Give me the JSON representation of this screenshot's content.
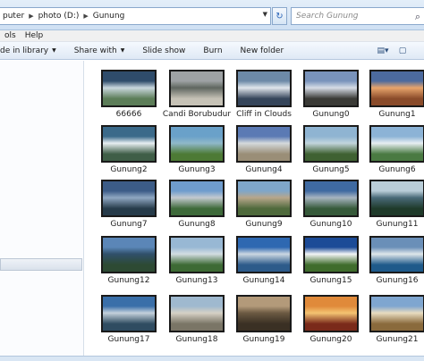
{
  "address": {
    "crumbs": [
      "puter",
      "photo (D:)",
      "Gunung"
    ]
  },
  "search": {
    "placeholder": "Search Gunung"
  },
  "menu": {
    "items": [
      "ols",
      "Help"
    ]
  },
  "commands": {
    "include": "de in library",
    "share": "Share with",
    "slideshow": "Slide show",
    "burn": "Burn",
    "newfolder": "New folder"
  },
  "icons": {
    "views": "view-options-icon",
    "preview": "preview-pane-icon",
    "help": "help-icon",
    "refresh": "refresh-icon",
    "search": "search-icon"
  },
  "files": [
    {
      "name": "66666",
      "c1": "#2f4c6b",
      "c2": "#c9d7de",
      "c3": "#5c7d58"
    },
    {
      "name": "Candi Borubudur",
      "c1": "#9ea2a4",
      "c2": "#5f6660",
      "c3": "#c6c2b6"
    },
    {
      "name": "Cliff in Clouds",
      "c1": "#6d8aa7",
      "c2": "#e0e6ec",
      "c3": "#35455a"
    },
    {
      "name": "Gunung0",
      "c1": "#7993bb",
      "c2": "#d6dce6",
      "c3": "#3a3a36"
    },
    {
      "name": "Gunung1",
      "c1": "#4c6a9e",
      "c2": "#e7a46c",
      "c3": "#8a4b2a"
    },
    {
      "name": "Gunung2",
      "c1": "#3b6a8a",
      "c2": "#e7eef2",
      "c3": "#3f5e47"
    },
    {
      "name": "Gunung3",
      "c1": "#6aa1c9",
      "c2": "#8fb8c9",
      "c3": "#4d7a35"
    },
    {
      "name": "Gunung4",
      "c1": "#5b7ab4",
      "c2": "#d4d9dc",
      "c3": "#9a8e77"
    },
    {
      "name": "Gunung5",
      "c1": "#8fb4d2",
      "c2": "#c2d5dc",
      "c3": "#3f6132"
    },
    {
      "name": "Gunung6",
      "c1": "#8cb3d6",
      "c2": "#e7eef2",
      "c3": "#4a7a42"
    },
    {
      "name": "Gunung7",
      "c1": "#3c5c87",
      "c2": "#8fa7c2",
      "c3": "#263b4a"
    },
    {
      "name": "Gunung8",
      "c1": "#6f9ccd",
      "c2": "#c3c9cf",
      "c3": "#3e6a3a"
    },
    {
      "name": "Gunung9",
      "c1": "#7fa6c9",
      "c2": "#b7a68b",
      "c3": "#4f6a3c"
    },
    {
      "name": "Gunung10",
      "c1": "#3f6aa1",
      "c2": "#a7b4c0",
      "c3": "#365a3a"
    },
    {
      "name": "Gunung11",
      "c1": "#b9cdd8",
      "c2": "#496a78",
      "c3": "#1f3a2a"
    },
    {
      "name": "Gunung12",
      "c1": "#5b86b7",
      "c2": "#30506b",
      "c3": "#2d4a33"
    },
    {
      "name": "Gunung13",
      "c1": "#98b8d4",
      "c2": "#d3dde2",
      "c3": "#3d6a34"
    },
    {
      "name": "Gunung14",
      "c1": "#2e68b1",
      "c2": "#cbd7e2",
      "c3": "#2d5b8a"
    },
    {
      "name": "Gunung15",
      "c1": "#1c4b97",
      "c2": "#f2f4f6",
      "c3": "#3f6c2c"
    },
    {
      "name": "Gunung16",
      "c1": "#6a8fb8",
      "c2": "#dfe6ea",
      "c3": "#1f5a8a"
    },
    {
      "name": "Gunung17",
      "c1": "#3a6fa9",
      "c2": "#c4d1dc",
      "c3": "#2f4c61"
    },
    {
      "name": "Gunung18",
      "c1": "#9fb9cf",
      "c2": "#d6d1c5",
      "c3": "#7a7566"
    },
    {
      "name": "Gunung19",
      "c1": "#b39a7a",
      "c2": "#6c5a42",
      "c3": "#3a3024"
    },
    {
      "name": "Gunung20",
      "c1": "#e08a3a",
      "c2": "#f4c472",
      "c3": "#7a2a1a"
    },
    {
      "name": "Gunung21",
      "c1": "#7fa6d0",
      "c2": "#e8dcc0",
      "c3": "#8a6a3c"
    }
  ]
}
